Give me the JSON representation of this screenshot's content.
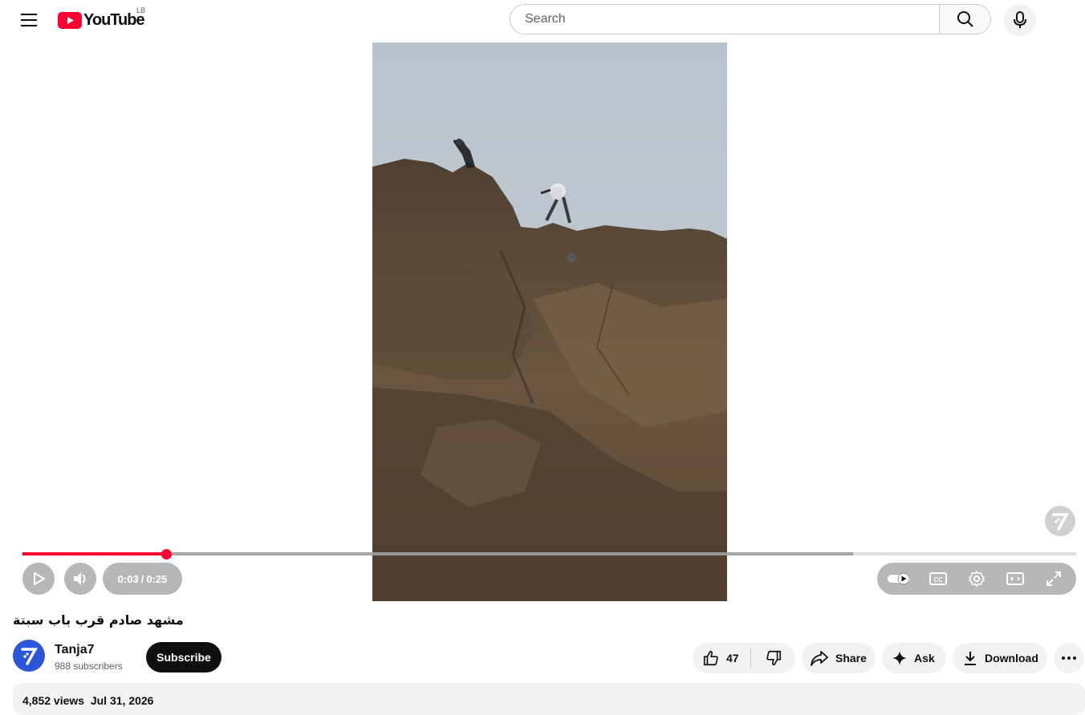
{
  "header": {
    "logo_text": "YouTube",
    "region": "LB",
    "search_placeholder": "Search"
  },
  "player": {
    "current_time": "0:03",
    "separator": "/",
    "duration": "0:25",
    "played_fraction": 0.137,
    "buffered_fraction": 0.788,
    "accent": "#ff0033"
  },
  "video": {
    "title": "مشهد صادم قرب باب سبتة",
    "channel": "Tanja7",
    "subscribers": "988 subscribers",
    "subscribe_label": "Subscribe",
    "views": "4,852 views",
    "date": "Jul 31, 2026"
  },
  "actions": {
    "likes": "47",
    "share": "Share",
    "ask": "Ask",
    "download": "Download"
  },
  "icons": {
    "menu": "hamburger-icon",
    "search": "search-icon",
    "mic": "mic-icon",
    "play": "play-icon",
    "volume": "volume-icon",
    "autoplay": "autoplay-toggle-icon",
    "captions": "cc-icon",
    "settings": "gear-icon",
    "theater": "theater-icon",
    "fullscreen": "fullscreen-icon",
    "like": "thumbs-up-icon",
    "dislike": "thumbs-down-icon",
    "share": "share-icon",
    "ask": "sparkle-icon",
    "download": "download-icon",
    "more": "more-horizontal-icon"
  }
}
